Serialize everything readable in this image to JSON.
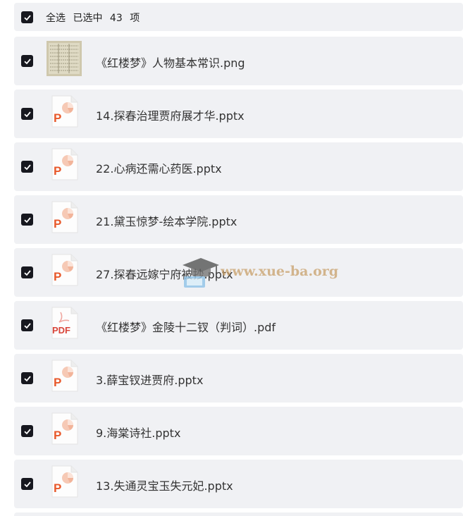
{
  "header": {
    "select_all": "全选",
    "selected_prefix": "已选中",
    "count": "43",
    "unit": "项"
  },
  "files": [
    {
      "name": "《红楼梦》人物基本常识.png",
      "type": "png",
      "checked": true
    },
    {
      "name": "14.探春治理贾府展才华.pptx",
      "type": "pptx",
      "checked": true
    },
    {
      "name": "22.心病还需心药医.pptx",
      "type": "pptx",
      "checked": true
    },
    {
      "name": "21.黛玉惊梦-绘本学院.pptx",
      "type": "pptx",
      "checked": true
    },
    {
      "name": "27.探春远嫁宁府被抄.pptx",
      "type": "pptx",
      "checked": true
    },
    {
      "name": "《红楼梦》金陵十二钗（判词）.pdf",
      "type": "pdf",
      "checked": true
    },
    {
      "name": "3.薛宝钗进贾府.pptx",
      "type": "pptx",
      "checked": true
    },
    {
      "name": "9.海棠诗社.pptx",
      "type": "pptx",
      "checked": true
    },
    {
      "name": "13.失通灵宝玉失元妃.pptx",
      "type": "pptx",
      "checked": true
    }
  ],
  "watermark": {
    "text": "www.xue-ba.org"
  },
  "colors": {
    "row_bg": "#f0f1f4",
    "checkbox": "#17181f",
    "ppt_orange": "#e8582a",
    "pdf_red": "#d9453a"
  }
}
